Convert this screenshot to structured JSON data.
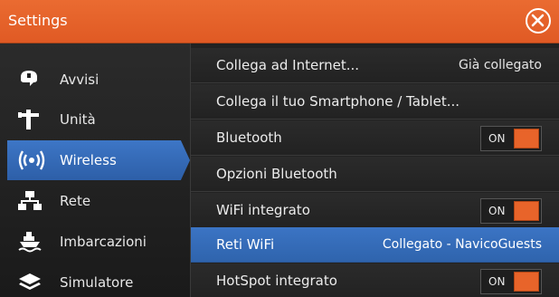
{
  "titlebar": {
    "title": "Settings"
  },
  "colors": {
    "accent": "#e8642a",
    "selection": "#3b74c4"
  },
  "sidebar": {
    "items": [
      {
        "label": "Avvisi",
        "icon": "speaker-alert-icon"
      },
      {
        "label": "Unità",
        "icon": "units-icon"
      },
      {
        "label": "Wireless",
        "icon": "wireless-icon",
        "active": true
      },
      {
        "label": "Rete",
        "icon": "network-icon"
      },
      {
        "label": "Imbarcazioni",
        "icon": "vessel-icon"
      },
      {
        "label": "Simulatore",
        "icon": "layers-icon"
      }
    ]
  },
  "content": {
    "rows": [
      {
        "label": "Collega ad Internet...",
        "value": "Già collegato"
      },
      {
        "label": "Collega il tuo Smartphone / Tablet..."
      },
      {
        "label": "Bluetooth",
        "toggle": "ON"
      },
      {
        "label": "Opzioni Bluetooth"
      },
      {
        "label": "WiFi integrato",
        "toggle": "ON"
      },
      {
        "label": "Reti WiFi",
        "value": "Collegato - NavicoGuests",
        "selected": true
      },
      {
        "label": "HotSpot integrato",
        "toggle": "ON"
      }
    ]
  }
}
